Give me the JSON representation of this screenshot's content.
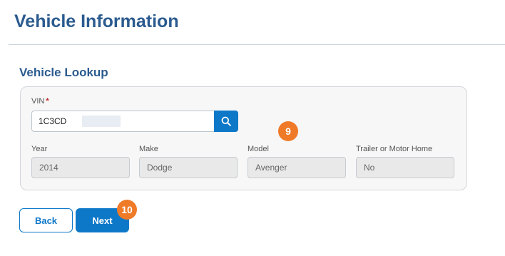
{
  "page": {
    "title": "Vehicle Information"
  },
  "lookup": {
    "section_title": "Vehicle Lookup",
    "vin": {
      "label": "VIN",
      "required_marker": "*",
      "value": "1C3CD"
    },
    "search": {
      "icon": "search-icon"
    },
    "fields": {
      "year": {
        "label": "Year",
        "value": "2014"
      },
      "make": {
        "label": "Make",
        "value": "Dodge"
      },
      "model": {
        "label": "Model",
        "value": "Avenger"
      },
      "trailer": {
        "label": "Trailer or Motor Home",
        "value": "No"
      }
    }
  },
  "badges": {
    "step_9": "9",
    "step_10": "10",
    "color": "#ef7a28"
  },
  "actions": {
    "back_label": "Back",
    "next_label": "Next"
  },
  "colors": {
    "accent": "#0d78c8",
    "heading": "#2b5b8f",
    "required": "#c0262d"
  }
}
